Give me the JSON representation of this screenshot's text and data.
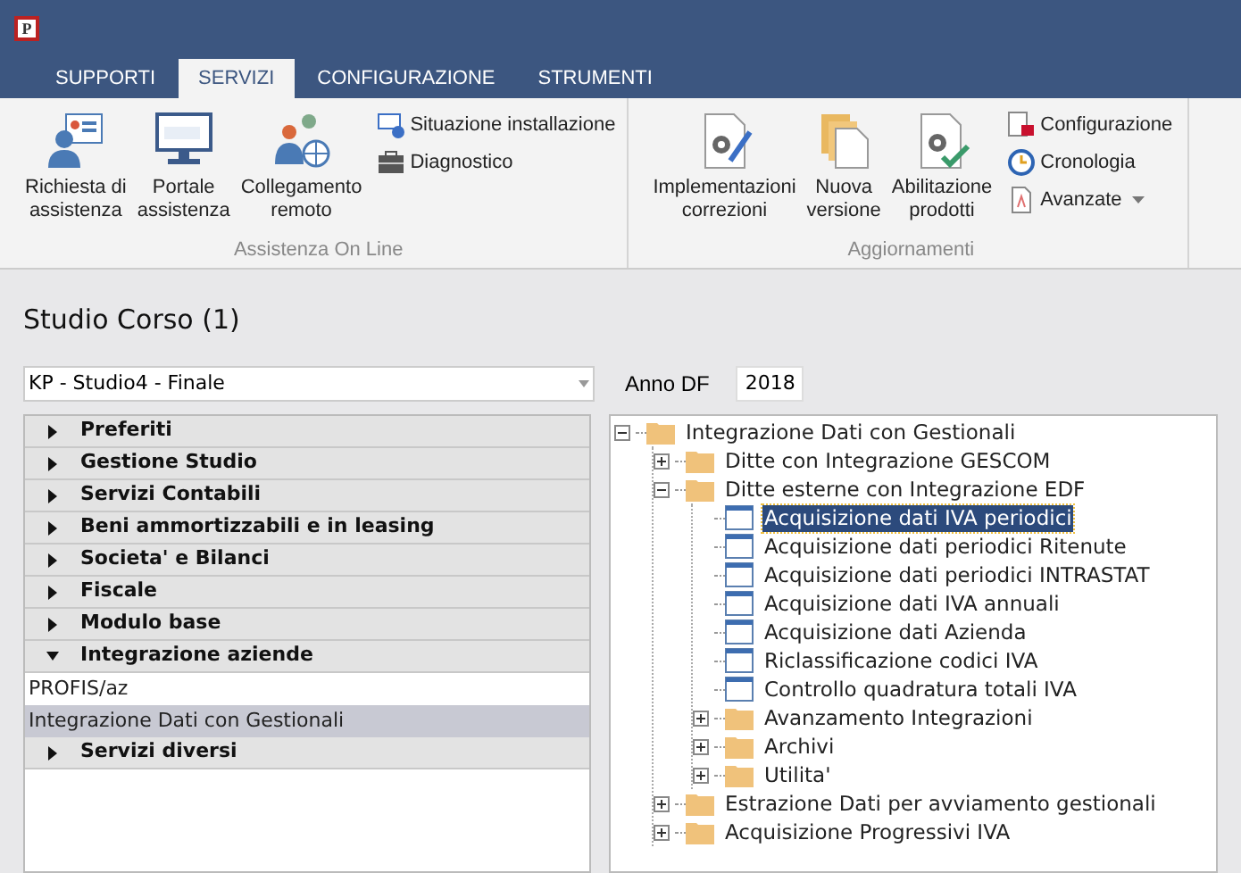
{
  "window": {
    "icon_letter": "P"
  },
  "tabs": [
    {
      "label": "SUPPORTI",
      "selected": false
    },
    {
      "label": "SERVIZI",
      "selected": true
    },
    {
      "label": "CONFIGURAZIONE",
      "selected": false
    },
    {
      "label": "STRUMENTI",
      "selected": false
    }
  ],
  "ribbon_groups": [
    {
      "label": "Assistenza On Line",
      "large_buttons": [
        "Richiesta di\nassistenza",
        "Portale\nassistenza",
        "Collegamento\nremoto"
      ],
      "small_buttons": [
        {
          "label": "Situazione installazione",
          "dropdown": false
        },
        {
          "label": "Diagnostico",
          "dropdown": false
        }
      ]
    },
    {
      "label": "Aggiornamenti",
      "large_buttons": [
        "Implementazioni\ncorrezioni",
        "Nuova\nversione",
        "Abilitazione\nprodotti"
      ],
      "small_buttons": [
        {
          "label": "Configurazione",
          "dropdown": false
        },
        {
          "label": "Cronologia",
          "dropdown": false
        },
        {
          "label": "Avanzate",
          "dropdown": true
        }
      ]
    }
  ],
  "page_title": "Studio Corso (1)",
  "company_select": {
    "value": "KP - Studio4 - Finale"
  },
  "year_field": {
    "label": "Anno DF",
    "value": "2018"
  },
  "sidebar": {
    "sections": [
      {
        "label": "Preferiti",
        "expanded": false
      },
      {
        "label": "Gestione Studio",
        "expanded": false
      },
      {
        "label": "Servizi Contabili",
        "expanded": false
      },
      {
        "label": "Beni ammortizzabili e in leasing",
        "expanded": false
      },
      {
        "label": "Societa' e Bilanci",
        "expanded": false
      },
      {
        "label": "Fiscale",
        "expanded": false
      },
      {
        "label": "Modulo base",
        "expanded": false
      },
      {
        "label": "Integrazione aziende",
        "expanded": true,
        "items": [
          {
            "label": "PROFIS/az",
            "selected": false
          },
          {
            "label": "Integrazione Dati con Gestionali",
            "selected": true
          }
        ]
      },
      {
        "label": "Servizi diversi",
        "expanded": false
      }
    ]
  },
  "tree": [
    {
      "label": "Integrazione Dati con Gestionali",
      "kind": "folder",
      "expanded": true,
      "selected": false,
      "children": [
        {
          "label": "Ditte con Integrazione GESCOM",
          "kind": "folder",
          "expanded": false,
          "selected": false
        },
        {
          "label": "Ditte esterne con Integrazione EDF",
          "kind": "folder",
          "expanded": true,
          "selected": false,
          "children": [
            {
              "label": "Acquisizione dati IVA periodici",
              "kind": "form",
              "selected": true
            },
            {
              "label": "Acquisizione dati periodici Ritenute",
              "kind": "form",
              "selected": false
            },
            {
              "label": "Acquisizione dati periodici INTRASTAT",
              "kind": "form",
              "selected": false
            },
            {
              "label": "Acquisizione dati IVA annuali",
              "kind": "form",
              "selected": false
            },
            {
              "label": "Acquisizione dati Azienda",
              "kind": "form",
              "selected": false
            },
            {
              "label": "Riclassificazione codici IVA",
              "kind": "form",
              "selected": false
            },
            {
              "label": "Controllo quadratura totali IVA",
              "kind": "form",
              "selected": false
            },
            {
              "label": "Avanzamento Integrazioni",
              "kind": "folder",
              "expanded": false,
              "selected": false
            },
            {
              "label": "Archivi",
              "kind": "folder",
              "expanded": false,
              "selected": false
            },
            {
              "label": "Utilita'",
              "kind": "folder",
              "expanded": false,
              "selected": false
            }
          ]
        },
        {
          "label": "Estrazione Dati per avviamento gestionali",
          "kind": "folder",
          "expanded": false,
          "selected": false
        },
        {
          "label": "Acquisizione Progressivi IVA",
          "kind": "folder",
          "expanded": false,
          "selected": false
        }
      ]
    }
  ]
}
